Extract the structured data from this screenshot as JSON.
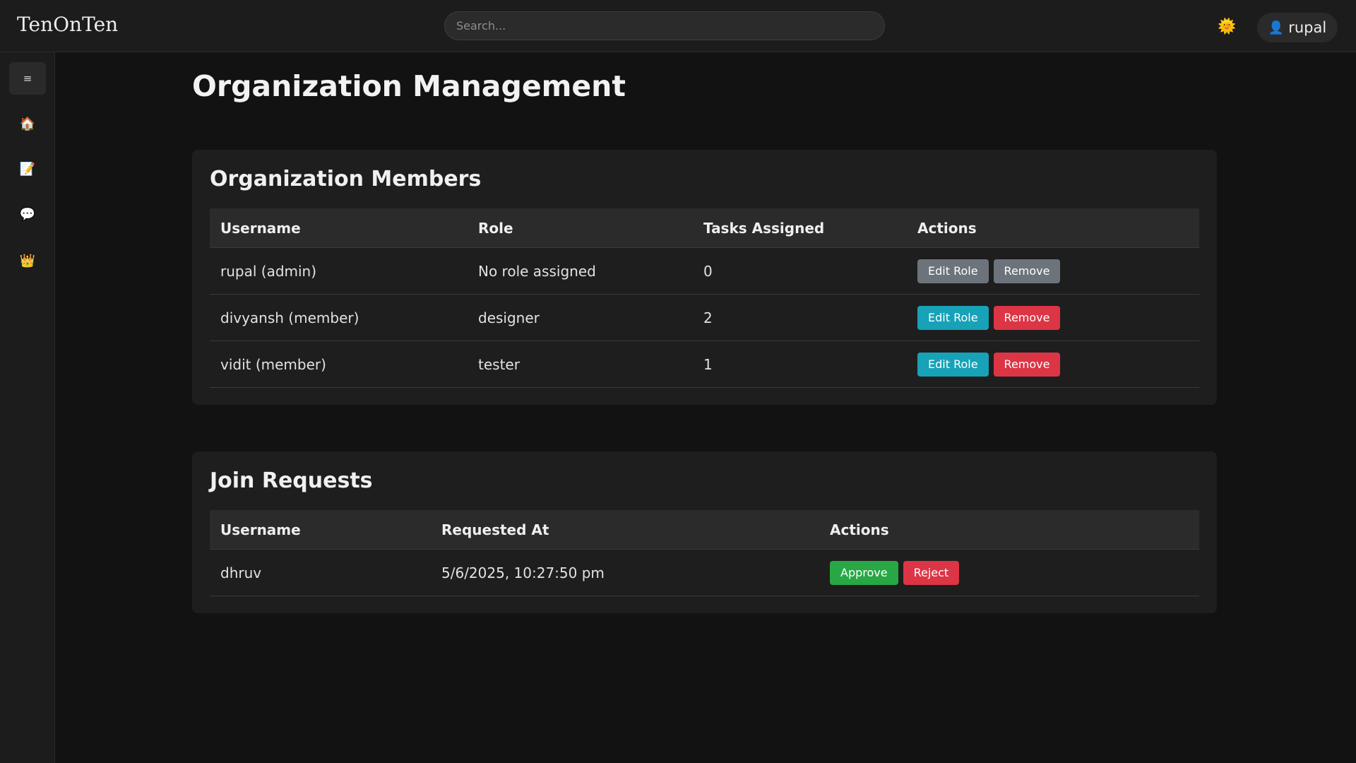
{
  "app": {
    "logo": "TenOnTen"
  },
  "search": {
    "placeholder": "Search..."
  },
  "header": {
    "theme_icon": "🌞",
    "user_icon": "👤",
    "username": "rupal"
  },
  "sidebar": {
    "items": [
      {
        "name": "menu",
        "icon": "≡"
      },
      {
        "name": "home",
        "icon": "🏠"
      },
      {
        "name": "notes",
        "icon": "📝"
      },
      {
        "name": "chat",
        "icon": "💬"
      },
      {
        "name": "organization",
        "icon": "👑"
      }
    ]
  },
  "page": {
    "title": "Organization Management"
  },
  "members": {
    "title": "Organization Members",
    "columns": [
      "Username",
      "Role",
      "Tasks Assigned",
      "Actions"
    ],
    "rows": [
      {
        "username": "rupal (admin)",
        "role": "No role assigned",
        "tasks": "0",
        "edit": "Edit Role",
        "remove": "Remove"
      },
      {
        "username": "divyansh (member)",
        "role": "designer",
        "tasks": "2",
        "edit": "Edit Role",
        "remove": "Remove"
      },
      {
        "username": "vidit (member)",
        "role": "tester",
        "tasks": "1",
        "edit": "Edit Role",
        "remove": "Remove"
      }
    ]
  },
  "requests": {
    "title": "Join Requests",
    "columns": [
      "Username",
      "Requested At",
      "Actions"
    ],
    "rows": [
      {
        "username": "dhruv",
        "requested_at": "5/6/2025, 10:27:50 pm",
        "approve": "Approve",
        "reject": "Reject"
      }
    ]
  },
  "colors": {
    "background": "#121212",
    "panel": "#1e1e1e",
    "edit_button": "#17a2b8",
    "remove_button": "#dc3545",
    "approve_button": "#28a745",
    "disabled_button": "#6c737a"
  }
}
